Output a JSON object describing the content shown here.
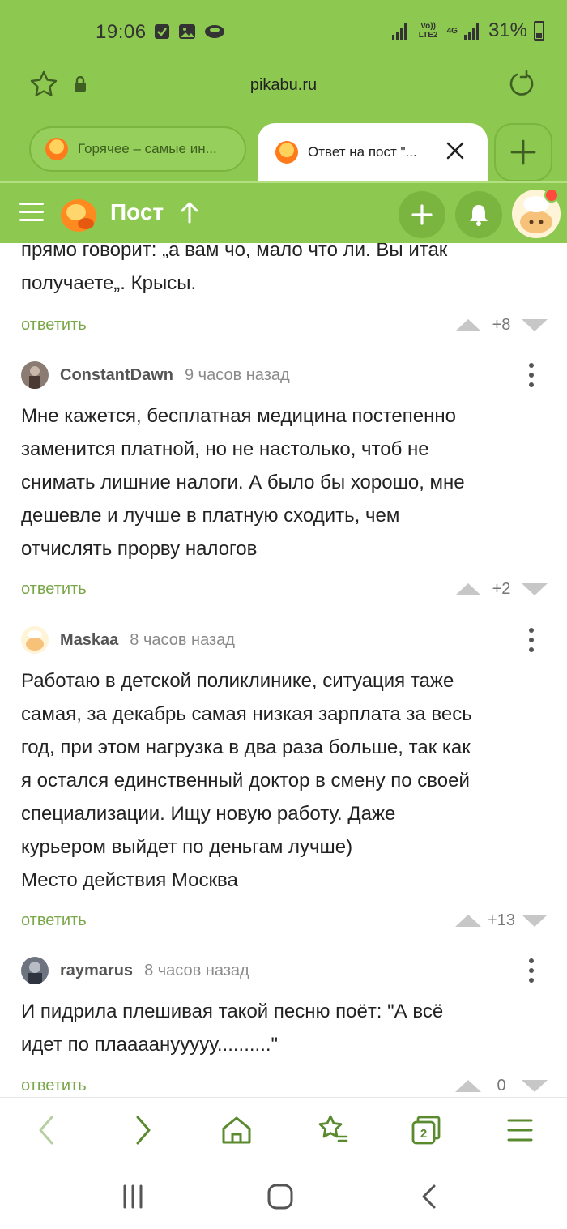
{
  "status_bar": {
    "time": "19:06",
    "network": "Vo)) LTE2",
    "network_type": "4G",
    "battery": "31%"
  },
  "browser": {
    "url": "pikabu.ru",
    "tabs": [
      {
        "title": "Горячее – самые ин...",
        "active": false
      },
      {
        "title": "Ответ на пост \"...",
        "active": true
      }
    ]
  },
  "site_header": {
    "title": "Пост"
  },
  "comments": [
    {
      "author": "",
      "time": "",
      "text": "прямо говорит: „а вам чо, мало что ли. Вы итак\nполучаете„. Крысы.",
      "reply_label": "ответить",
      "score": "+8"
    },
    {
      "author": "ConstantDawn",
      "time": "9 часов назад",
      "text": "Мне кажется, бесплатная медицина постепенно\nзаменится платной, но не настолько, чтоб не\nснимать лишние налоги. А было бы хорошо, мне\nдешевле и лучше в платную сходить, чем\nотчислять прорву налогов",
      "reply_label": "ответить",
      "score": "+2"
    },
    {
      "author": "Maskaa",
      "time": "8 часов назад",
      "text": "Работаю в детской поликлинике, ситуация таже\nсамая, за декабрь самая низкая зарплата за весь\nгод, при этом нагрузка в два раза больше, так как\nя остался единственный доктор в смену по своей\nспециализации. Ищу новую работу. Даже\nкурьером выйдет по деньгам лучше)\nМесто действия Москва",
      "reply_label": "ответить",
      "score": "+13"
    },
    {
      "author": "raymarus",
      "time": "8 часов назад",
      "text": "И пидрила плешивая такой песню поёт: \"А всё\nидет по плаааанууууу..........\"",
      "reply_label": "ответить",
      "score": "0"
    }
  ],
  "colors": {
    "brand_green": "#8dc950",
    "reply_green": "#7aa74a",
    "nav_icon_green": "#5a8a2e",
    "notification_red": "#ff4a3d"
  }
}
